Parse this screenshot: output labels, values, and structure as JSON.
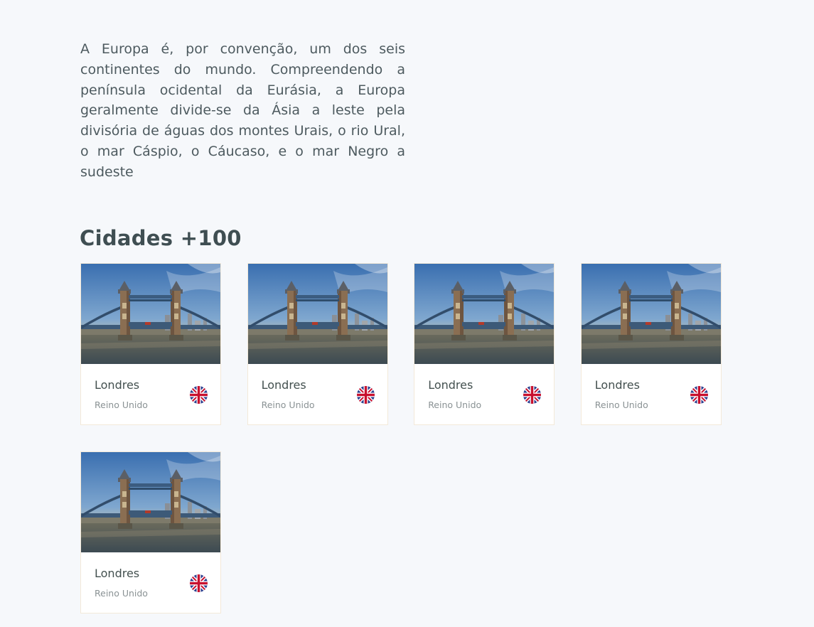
{
  "intro": {
    "text": "A Europa é, por convenção, um dos seis continentes do mundo. Compreendendo a península ocidental da Eurásia, a Europa geralmente divide-se da Ásia a leste pela divisória de águas dos montes Urais, o rio Ural, o mar Cáspio, o Cáucaso, e o mar Negro a sudeste"
  },
  "section": {
    "title": "Cidades +100"
  },
  "cities": [
    {
      "name": "Londres",
      "country": "Reino Unido",
      "flag_icon": "uk-flag-icon",
      "image": "tower-bridge-photo"
    },
    {
      "name": "Londres",
      "country": "Reino Unido",
      "flag_icon": "uk-flag-icon",
      "image": "tower-bridge-photo"
    },
    {
      "name": "Londres",
      "country": "Reino Unido",
      "flag_icon": "uk-flag-icon",
      "image": "tower-bridge-photo"
    },
    {
      "name": "Londres",
      "country": "Reino Unido",
      "flag_icon": "uk-flag-icon",
      "image": "tower-bridge-photo"
    },
    {
      "name": "Londres",
      "country": "Reino Unido",
      "flag_icon": "uk-flag-icon",
      "image": "tower-bridge-photo"
    }
  ],
  "colors": {
    "background": "#f6f8fb",
    "text": "#4d5a5f",
    "card_border": "#f3e9d9"
  }
}
